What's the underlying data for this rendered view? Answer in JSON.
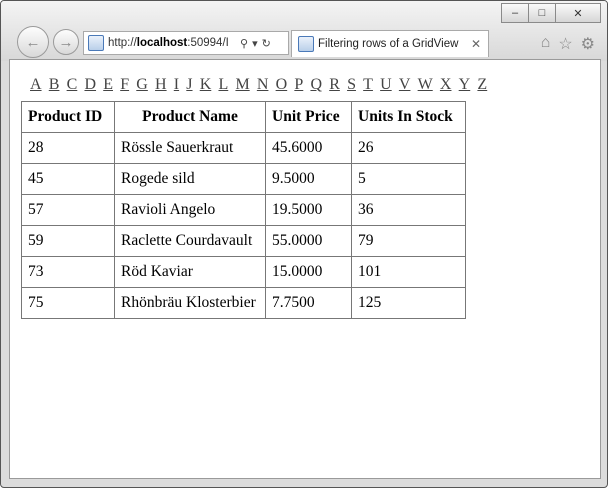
{
  "window": {
    "minimize": "–",
    "maximize": "□",
    "close": "✕"
  },
  "address_bar": {
    "url_prefix": "http://",
    "url_host": "localhost",
    "url_rest": ":50994/I"
  },
  "tab": {
    "title": "Filtering rows of a GridView",
    "close": "✕"
  },
  "letters": [
    "A",
    "B",
    "C",
    "D",
    "E",
    "F",
    "G",
    "H",
    "I",
    "J",
    "K",
    "L",
    "M",
    "N",
    "O",
    "P",
    "Q",
    "R",
    "S",
    "T",
    "U",
    "V",
    "W",
    "X",
    "Y",
    "Z"
  ],
  "grid": {
    "headers": [
      "Product ID",
      "Product Name",
      "Unit Price",
      "Units In Stock"
    ],
    "rows": [
      [
        "28",
        "Rössle Sauerkraut",
        "45.6000",
        "26"
      ],
      [
        "45",
        "Rogede sild",
        "9.5000",
        "5"
      ],
      [
        "57",
        "Ravioli Angelo",
        "19.5000",
        "36"
      ],
      [
        "59",
        "Raclette Courdavault",
        "55.0000",
        "79"
      ],
      [
        "73",
        "Röd Kaviar",
        "15.0000",
        "101"
      ],
      [
        "75",
        "Rhönbräu Klosterbier",
        "7.7500",
        "125"
      ]
    ]
  }
}
